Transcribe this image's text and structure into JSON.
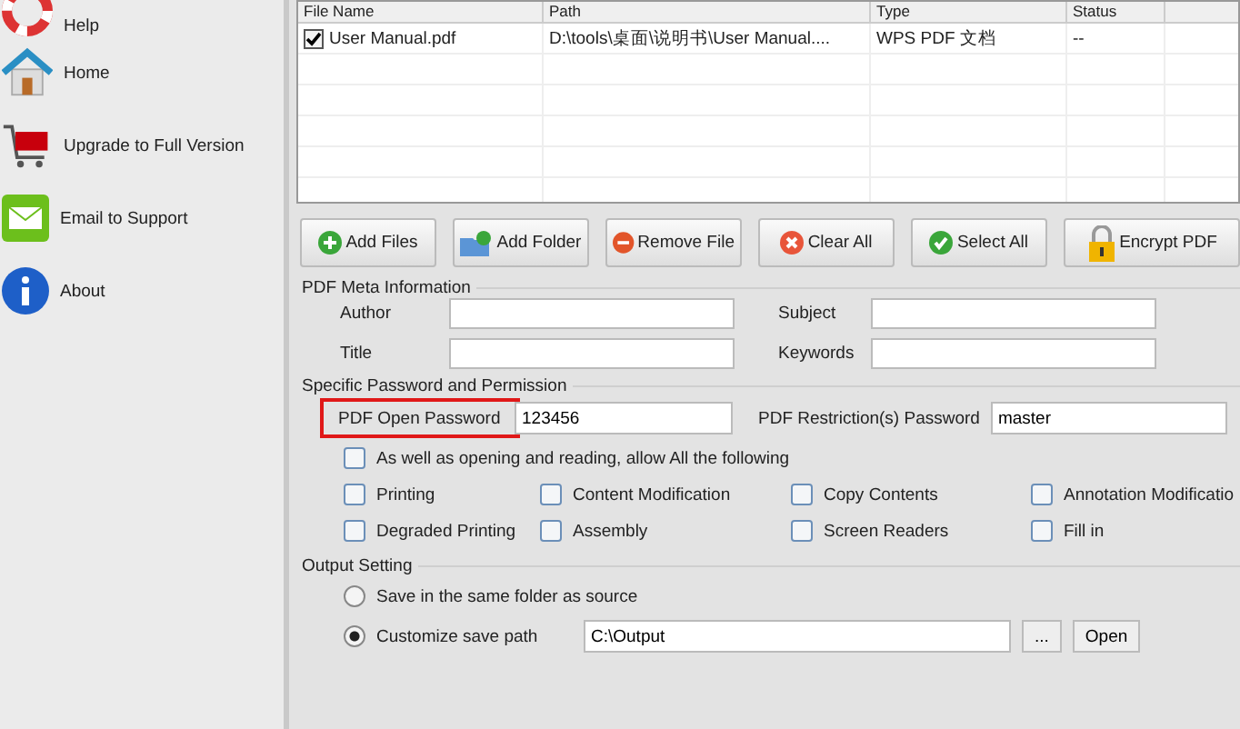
{
  "sidebar": {
    "items": [
      {
        "label": "Help"
      },
      {
        "label": "Home"
      },
      {
        "label": "Upgrade to Full Version"
      },
      {
        "label": "Email to Support"
      },
      {
        "label": "About"
      }
    ]
  },
  "table": {
    "columns": [
      "File Name",
      "Path",
      "Type",
      "Status"
    ],
    "rows": [
      {
        "checked": true,
        "cells": [
          "User Manual.pdf",
          "D:\\tools\\桌面\\说明书\\User Manual....",
          "WPS PDF 文档",
          "--"
        ]
      }
    ]
  },
  "buttons": [
    {
      "label": "Add Files"
    },
    {
      "label": "Add Folder"
    },
    {
      "label": "Remove File"
    },
    {
      "label": "Clear All"
    },
    {
      "label": "Select All"
    },
    {
      "label": "Encrypt PDF"
    }
  ],
  "meta": {
    "title": "PDF Meta Information",
    "fields": [
      {
        "label": "Author"
      },
      {
        "label": "Subject"
      },
      {
        "label": "Title"
      },
      {
        "label": "Keywords"
      }
    ]
  },
  "permission": {
    "title": "Specific Password and Permission",
    "open_password": {
      "label": "PDF Open Password",
      "value": "123456"
    },
    "restriction_password": {
      "label": "PDF Restriction(s) Password",
      "value": "master"
    },
    "allow_all": {
      "label": "As well as opening and reading, allow All the following",
      "checked": false
    },
    "options": [
      {
        "label": "Printing",
        "checked": false
      },
      {
        "label": "Content Modification",
        "checked": false
      },
      {
        "label": "Copy Contents",
        "checked": false
      },
      {
        "label": "Annotation Modificatio",
        "checked": false
      },
      {
        "label": "Degraded Printing",
        "checked": false
      },
      {
        "label": "Assembly",
        "checked": false
      },
      {
        "label": "Screen Readers",
        "checked": false
      },
      {
        "label": "Fill in",
        "checked": false
      }
    ]
  },
  "output": {
    "title": "Output Setting",
    "choices": [
      {
        "label": "Save in the same folder as source",
        "selected": false
      },
      {
        "label": "Customize save path",
        "selected": true
      }
    ],
    "path": "C:\\Output",
    "browse": "...",
    "open": "Open"
  }
}
